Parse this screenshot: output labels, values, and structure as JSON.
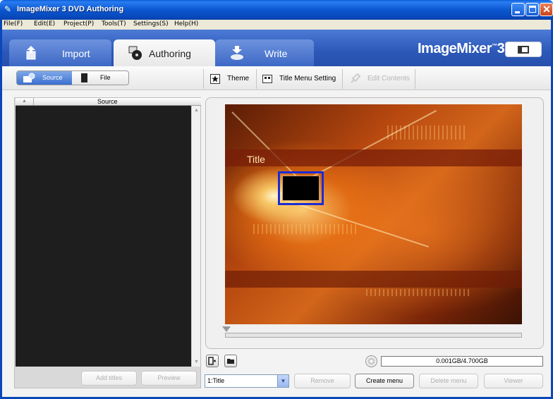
{
  "window": {
    "title": "ImageMixer 3 DVD Authoring"
  },
  "menu": [
    "File(F)",
    "Edit(E)",
    "Project(P)",
    "Tools(T)",
    "Settings(S)",
    "Help(H)"
  ],
  "tabs": {
    "import": "Import",
    "authoring": "Authoring",
    "write": "Write"
  },
  "brand": {
    "name": "ImageMixer",
    "superscript": "™",
    "version": "3"
  },
  "subbar": {
    "source": "Source",
    "file": "File",
    "theme": "Theme",
    "title_menu_setting": "Title Menu Setting",
    "edit_contents": "Edit Contents"
  },
  "left": {
    "column_header": "Source",
    "add_titles": "Add titles",
    "preview": "Preview"
  },
  "preview": {
    "title_text": "Title"
  },
  "capacity": "0.001GB/4.700GB",
  "bottom": {
    "selected_title": "1:Title",
    "remove": "Remove",
    "create_menu": "Create menu",
    "delete_menu": "Delete menu",
    "viewer": "Viewer"
  },
  "colors": {
    "titlebar": "#0b57d0",
    "tab_active": "#ececec",
    "source_btn": "#3b6fd0",
    "selection_border": "#1a2cd6"
  }
}
